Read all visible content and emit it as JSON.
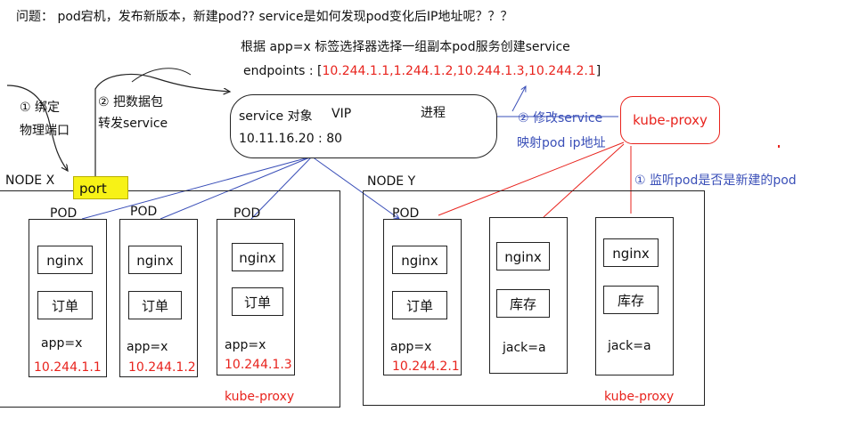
{
  "question": "问题： pod宕机，发布新版本，新建pod?? service是如何发现pod变化后IP地址呢？？？",
  "selector_note": "根据 app=x 标签选择器选择一组副本pod服务创建service",
  "endpoints": {
    "label": "endpoints :",
    "open": "[",
    "values": "10.244.1.1,1.244.1.2,10.244.1.3,10.244.2.1",
    "close": "]"
  },
  "annotations": {
    "bind_port_line1": "① 绑定",
    "bind_port_line2": "物理端口",
    "forward_line1": "② 把数据包",
    "forward_line2": "转发service",
    "modify_service": "② 修改service",
    "map_pod_ip": "映射pod ip地址",
    "watch_pod": "① 监听pod是否是新建的pod"
  },
  "service": {
    "object_label": "service 对象",
    "vip_label": "VIP",
    "process_label": "进程",
    "address": "10.11.16.20 : 80"
  },
  "kube_proxy_main": "kube-proxy",
  "nodes": [
    {
      "name": "NODE X",
      "proxy": "kube-proxy",
      "port_label": "port"
    },
    {
      "name": "NODE Y",
      "proxy": "kube-proxy"
    }
  ],
  "pods": [
    {
      "title": "POD",
      "c1": "nginx",
      "c2": "订单",
      "label": "app=x",
      "ip": "10.244.1.1"
    },
    {
      "title": "POD",
      "c1": "nginx",
      "c2": "订单",
      "label": "app=x",
      "ip": "10.244.1.2"
    },
    {
      "title": "POD",
      "c1": "nginx",
      "c2": "订单",
      "label": "app=x",
      "ip": "10.244.1.3"
    },
    {
      "title": "POD",
      "c1": "nginx",
      "c2": "订单",
      "label": "app=x",
      "ip": "10.244.2.1"
    },
    {
      "title": "",
      "c1": "nginx",
      "c2": "库存",
      "label": "jack=a",
      "ip": ""
    },
    {
      "title": "",
      "c1": "nginx",
      "c2": "库存",
      "label": "jack=a",
      "ip": ""
    }
  ],
  "colors": {
    "red": "#e8231d",
    "blue": "#3a4fb8",
    "port_fill": "#f7f216"
  }
}
